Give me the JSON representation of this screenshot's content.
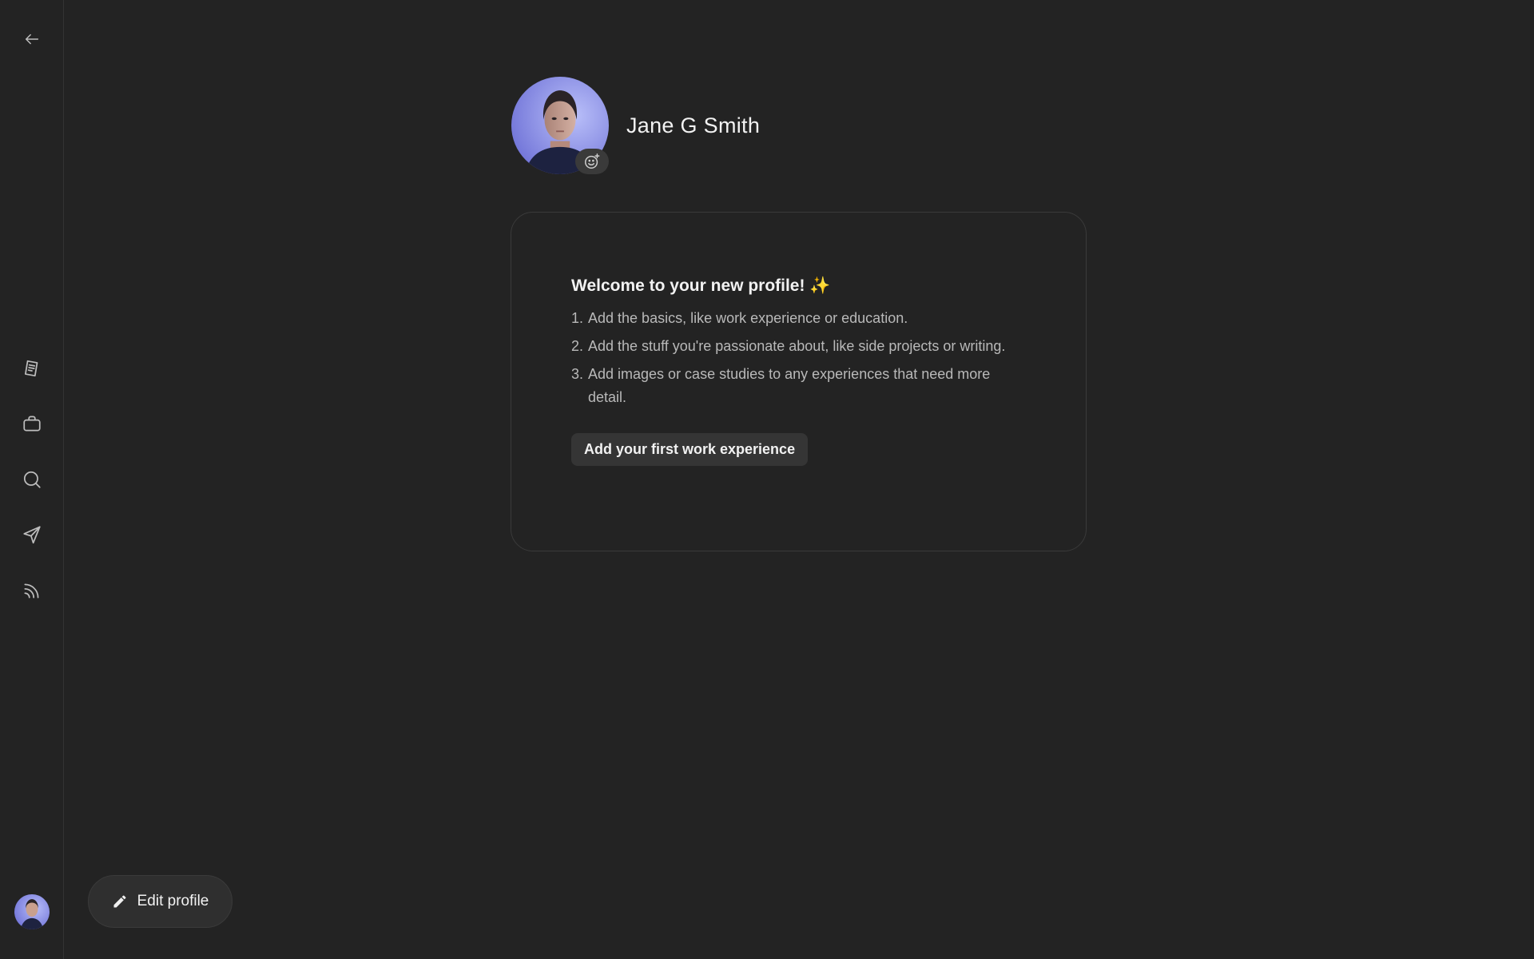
{
  "sidebar": {
    "icons": [
      "back-arrow-icon",
      "document-icon",
      "briefcase-icon",
      "search-icon",
      "send-icon",
      "feed-icon"
    ]
  },
  "profile": {
    "name": "Jane G Smith"
  },
  "card": {
    "title": "Welcome to your new profile!",
    "title_emoji": "✨",
    "steps": [
      {
        "num": "1.",
        "text": "Add the basics, like work experience or education."
      },
      {
        "num": "2.",
        "text": "Add the stuff you're passionate about, like side projects or writing."
      },
      {
        "num": "3.",
        "text": "Add images or case studies to any experiences that need more detail."
      }
    ],
    "button_label": "Add your first work experience"
  },
  "edit_button": {
    "label": "Edit profile"
  },
  "colors": {
    "background": "#232323",
    "border": "#3a3a3a",
    "text_primary": "#f2f2f2",
    "text_secondary": "#b9b9b9"
  }
}
